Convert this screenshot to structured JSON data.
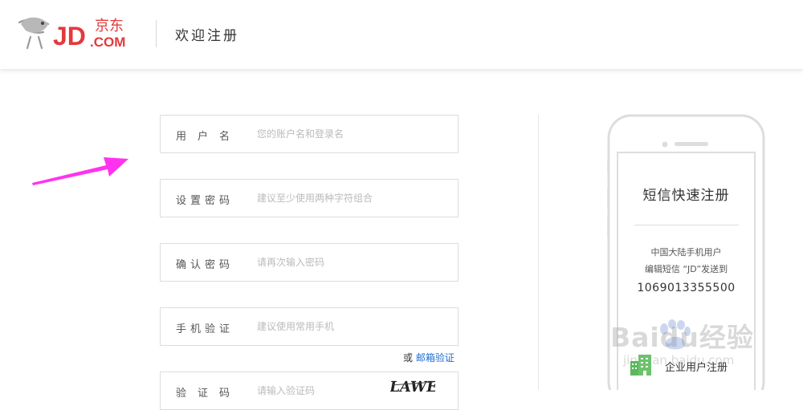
{
  "header": {
    "logo_text": "JD.京东.COM",
    "title": "欢迎注册"
  },
  "form": {
    "fields": [
      {
        "label": "用户名",
        "placeholder": "您的账户名和登录名"
      },
      {
        "label": "设置密码",
        "placeholder": "建议至少使用两种字符组合"
      },
      {
        "label": "确认密码",
        "placeholder": "请再次输入密码"
      },
      {
        "label": "手机验证",
        "placeholder": "建议使用常用手机"
      },
      {
        "label": "验证码",
        "placeholder": "请输入验证码"
      }
    ],
    "email_switch": {
      "prefix": "或",
      "link": "邮箱验证"
    },
    "captcha_text": "LAWE"
  },
  "sms": {
    "title": "短信快速注册",
    "line1": "中国大陆手机用户",
    "line2": "编辑短信 “JD”发送到",
    "number": "1069013355500"
  },
  "enterprise": {
    "label": "企业用户注册",
    "icon": "building-icon"
  },
  "annotation": {
    "arrow_color": "#ff33ee"
  },
  "watermark": {
    "text": "Baidu经验",
    "url": "jingyan.baidu.com"
  },
  "colors": {
    "brand": "#e4393c",
    "link": "#1f6fd1",
    "enterprise_icon": "#5cb85c"
  }
}
